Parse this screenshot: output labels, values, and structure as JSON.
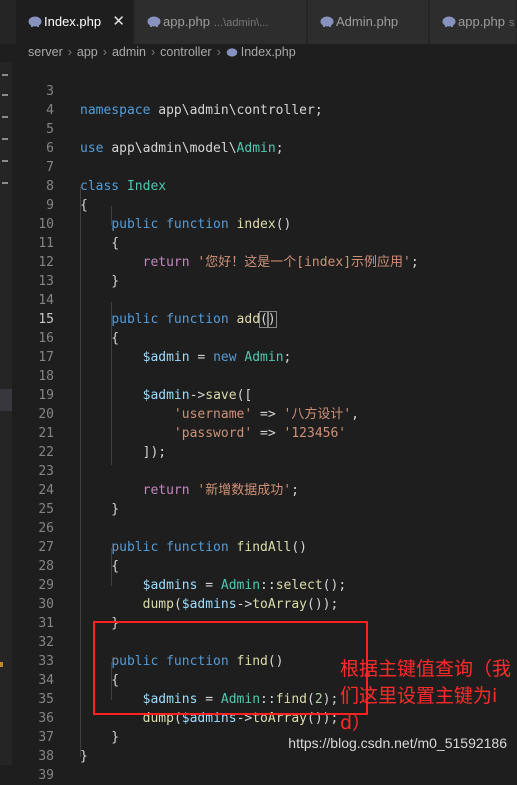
{
  "tabs": [
    {
      "label": "Index.php",
      "sub": "",
      "active": true,
      "close": "✕"
    },
    {
      "label": "app.php",
      "sub": "...\\admin\\...",
      "active": false
    },
    {
      "label": "Admin.php",
      "sub": "",
      "active": false
    },
    {
      "label": "app.php",
      "sub": "s",
      "active": false
    }
  ],
  "breadcrumb": [
    "server",
    "app",
    "admin",
    "controller",
    "Index.php"
  ],
  "colors": {
    "php_icon": "#8892bf",
    "annotation": "#ff2020",
    "editor_bg": "#1e1e1e"
  },
  "lines": [
    {
      "n": "3",
      "tokens": []
    },
    {
      "n": "4",
      "tokens": [
        [
          "k",
          "namespace "
        ],
        [
          "p",
          "app\\admin\\controller;"
        ]
      ]
    },
    {
      "n": "5",
      "tokens": []
    },
    {
      "n": "6",
      "tokens": [
        [
          "k",
          "use "
        ],
        [
          "p",
          "app\\admin\\model\\"
        ],
        [
          "t",
          "Admin"
        ],
        [
          "p",
          ";"
        ]
      ]
    },
    {
      "n": "7",
      "tokens": []
    },
    {
      "n": "8",
      "tokens": [
        [
          "k",
          "class "
        ],
        [
          "t",
          "Index"
        ]
      ]
    },
    {
      "n": "9",
      "tokens": [
        [
          "p",
          "{"
        ]
      ]
    },
    {
      "n": "10",
      "tokens": [
        [
          "p",
          "    "
        ],
        [
          "k",
          "public function "
        ],
        [
          "f",
          "index"
        ],
        [
          "p",
          "()"
        ]
      ]
    },
    {
      "n": "11",
      "tokens": [
        [
          "p",
          "    {"
        ]
      ]
    },
    {
      "n": "12",
      "tokens": [
        [
          "p",
          "        "
        ],
        [
          "c",
          "return "
        ],
        [
          "s",
          "'您好！这是一个[index]示例应用'"
        ],
        [
          "p",
          ";"
        ]
      ]
    },
    {
      "n": "13",
      "tokens": [
        [
          "p",
          "    }"
        ]
      ]
    },
    {
      "n": "14",
      "tokens": []
    },
    {
      "n": "15",
      "tokens": [
        [
          "p",
          "    "
        ],
        [
          "k",
          "public function "
        ],
        [
          "f",
          "add"
        ],
        [
          "bm",
          "("
        ],
        [
          "bm",
          ")"
        ]
      ],
      "current": true
    },
    {
      "n": "16",
      "tokens": [
        [
          "p",
          "    {"
        ]
      ]
    },
    {
      "n": "17",
      "tokens": [
        [
          "p",
          "        "
        ],
        [
          "v",
          "$admin"
        ],
        [
          "p",
          " = "
        ],
        [
          "k",
          "new "
        ],
        [
          "t",
          "Admin"
        ],
        [
          "p",
          ";"
        ]
      ]
    },
    {
      "n": "18",
      "tokens": []
    },
    {
      "n": "19",
      "tokens": [
        [
          "p",
          "        "
        ],
        [
          "v",
          "$admin"
        ],
        [
          "p",
          "->"
        ],
        [
          "f",
          "save"
        ],
        [
          "p",
          "(["
        ]
      ]
    },
    {
      "n": "20",
      "tokens": [
        [
          "p",
          "            "
        ],
        [
          "s",
          "'username'"
        ],
        [
          "p",
          " => "
        ],
        [
          "s",
          "'八方设计'"
        ],
        [
          "p",
          ","
        ]
      ]
    },
    {
      "n": "21",
      "tokens": [
        [
          "p",
          "            "
        ],
        [
          "s",
          "'password'"
        ],
        [
          "p",
          " => "
        ],
        [
          "s",
          "'123456'"
        ]
      ]
    },
    {
      "n": "22",
      "tokens": [
        [
          "p",
          "        ]);"
        ]
      ]
    },
    {
      "n": "23",
      "tokens": []
    },
    {
      "n": "24",
      "tokens": [
        [
          "p",
          "        "
        ],
        [
          "c",
          "return "
        ],
        [
          "s",
          "'新增数据成功'"
        ],
        [
          "p",
          ";"
        ]
      ]
    },
    {
      "n": "25",
      "tokens": [
        [
          "p",
          "    }"
        ]
      ]
    },
    {
      "n": "26",
      "tokens": []
    },
    {
      "n": "27",
      "tokens": [
        [
          "p",
          "    "
        ],
        [
          "k",
          "public function "
        ],
        [
          "f",
          "findAll"
        ],
        [
          "p",
          "()"
        ]
      ]
    },
    {
      "n": "28",
      "tokens": [
        [
          "p",
          "    {"
        ]
      ]
    },
    {
      "n": "29",
      "tokens": [
        [
          "p",
          "        "
        ],
        [
          "v",
          "$admins"
        ],
        [
          "p",
          " = "
        ],
        [
          "t",
          "Admin"
        ],
        [
          "p",
          "::"
        ],
        [
          "f",
          "select"
        ],
        [
          "p",
          "();"
        ]
      ]
    },
    {
      "n": "30",
      "tokens": [
        [
          "p",
          "        "
        ],
        [
          "f",
          "dump"
        ],
        [
          "p",
          "("
        ],
        [
          "v",
          "$admins"
        ],
        [
          "p",
          "->"
        ],
        [
          "f",
          "toArray"
        ],
        [
          "p",
          "());"
        ]
      ]
    },
    {
      "n": "31",
      "tokens": [
        [
          "p",
          "    }"
        ]
      ]
    },
    {
      "n": "32",
      "tokens": []
    },
    {
      "n": "33",
      "tokens": [
        [
          "p",
          "    "
        ],
        [
          "k",
          "public function "
        ],
        [
          "f",
          "find"
        ],
        [
          "p",
          "()"
        ]
      ]
    },
    {
      "n": "34",
      "tokens": [
        [
          "p",
          "    {"
        ]
      ]
    },
    {
      "n": "35",
      "tokens": [
        [
          "p",
          "        "
        ],
        [
          "v",
          "$admins"
        ],
        [
          "p",
          " = "
        ],
        [
          "t",
          "Admin"
        ],
        [
          "p",
          "::"
        ],
        [
          "f",
          "find"
        ],
        [
          "p",
          "("
        ],
        [
          "n",
          "2"
        ],
        [
          "p",
          ");"
        ]
      ]
    },
    {
      "n": "36",
      "tokens": [
        [
          "p",
          "        "
        ],
        [
          "f",
          "dump"
        ],
        [
          "p",
          "("
        ],
        [
          "v",
          "$admins"
        ],
        [
          "p",
          "->"
        ],
        [
          "f",
          "toArray"
        ],
        [
          "p",
          "());"
        ]
      ]
    },
    {
      "n": "37",
      "tokens": [
        [
          "p",
          "    }"
        ]
      ]
    },
    {
      "n": "38",
      "tokens": [
        [
          "p",
          "}"
        ]
      ]
    },
    {
      "n": "39",
      "tokens": []
    }
  ],
  "annotation": "根据主键值查询（我们这里设置主键为id）",
  "watermark": "https://blog.csdn.net/m0_51592186"
}
